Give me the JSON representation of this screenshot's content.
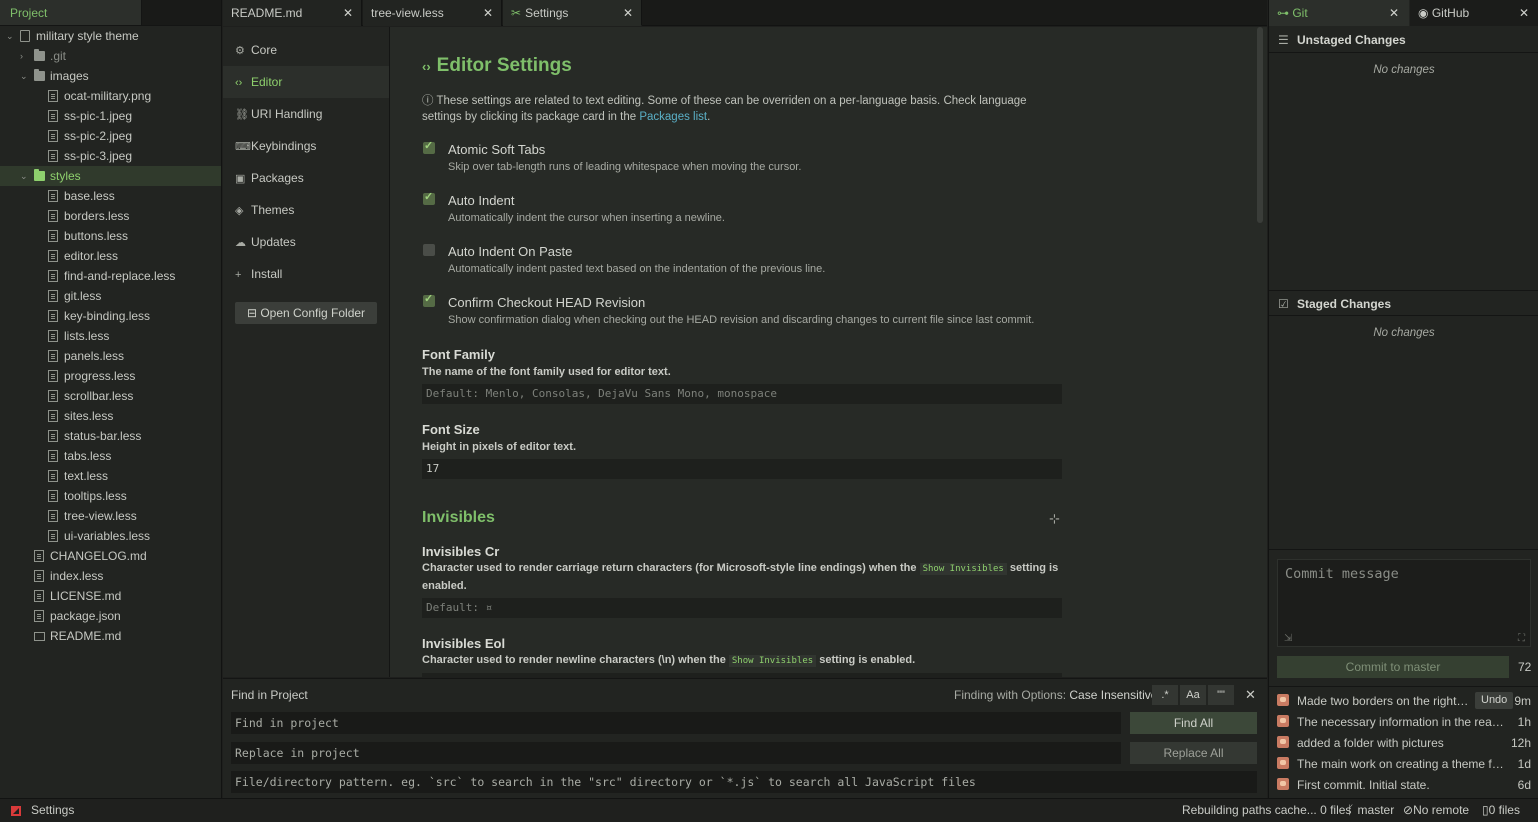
{
  "left_panel": {
    "tab_label": "Project",
    "tree": [
      {
        "label": "military style theme",
        "type": "repo",
        "depth": 0,
        "chevron": "down"
      },
      {
        "label": ".git",
        "type": "folder",
        "depth": 1,
        "chevron": "right",
        "dim": true
      },
      {
        "label": "images",
        "type": "folder",
        "depth": 1,
        "chevron": "down"
      },
      {
        "label": "ocat-military.png",
        "type": "file",
        "depth": 2
      },
      {
        "label": "ss-pic-1.jpeg",
        "type": "file",
        "depth": 2
      },
      {
        "label": "ss-pic-2.jpeg",
        "type": "file",
        "depth": 2
      },
      {
        "label": "ss-pic-3.jpeg",
        "type": "file",
        "depth": 2
      },
      {
        "label": "styles",
        "type": "folder",
        "depth": 1,
        "chevron": "down",
        "selected": true
      },
      {
        "label": "base.less",
        "type": "file",
        "depth": 2
      },
      {
        "label": "borders.less",
        "type": "file",
        "depth": 2
      },
      {
        "label": "buttons.less",
        "type": "file",
        "depth": 2
      },
      {
        "label": "editor.less",
        "type": "file",
        "depth": 2
      },
      {
        "label": "find-and-replace.less",
        "type": "file",
        "depth": 2
      },
      {
        "label": "git.less",
        "type": "file",
        "depth": 2
      },
      {
        "label": "key-binding.less",
        "type": "file",
        "depth": 2
      },
      {
        "label": "lists.less",
        "type": "file",
        "depth": 2
      },
      {
        "label": "panels.less",
        "type": "file",
        "depth": 2
      },
      {
        "label": "progress.less",
        "type": "file",
        "depth": 2
      },
      {
        "label": "scrollbar.less",
        "type": "file",
        "depth": 2
      },
      {
        "label": "sites.less",
        "type": "file",
        "depth": 2
      },
      {
        "label": "status-bar.less",
        "type": "file",
        "depth": 2
      },
      {
        "label": "tabs.less",
        "type": "file",
        "depth": 2
      },
      {
        "label": "text.less",
        "type": "file",
        "depth": 2
      },
      {
        "label": "tooltips.less",
        "type": "file",
        "depth": 2
      },
      {
        "label": "tree-view.less",
        "type": "file",
        "depth": 2
      },
      {
        "label": "ui-variables.less",
        "type": "file",
        "depth": 2
      },
      {
        "label": "CHANGELOG.md",
        "type": "file",
        "depth": 1
      },
      {
        "label": "index.less",
        "type": "file",
        "depth": 1
      },
      {
        "label": "LICENSE.md",
        "type": "file",
        "depth": 1
      },
      {
        "label": "package.json",
        "type": "file",
        "depth": 1
      },
      {
        "label": "README.md",
        "type": "book",
        "depth": 1
      }
    ]
  },
  "tabs": [
    {
      "label": "README.md",
      "icon": ""
    },
    {
      "label": "tree-view.less",
      "icon": ""
    },
    {
      "label": "Settings",
      "icon": "wrench-icon",
      "active": true
    }
  ],
  "settings_nav": {
    "items": [
      {
        "label": "Core",
        "icon": "⚙"
      },
      {
        "label": "Editor",
        "icon": "‹›",
        "active": true
      },
      {
        "label": "URI Handling",
        "icon": "⛓"
      },
      {
        "label": "Keybindings",
        "icon": "⌨"
      },
      {
        "label": "Packages",
        "icon": "▣"
      },
      {
        "label": "Themes",
        "icon": "◈"
      },
      {
        "label": "Updates",
        "icon": "☁"
      },
      {
        "label": "Install",
        "icon": "+"
      }
    ],
    "config_button": "Open Config Folder"
  },
  "editor_settings": {
    "title": "Editor Settings",
    "description_pre": "These settings are related to text editing. Some of these can be overriden on a per-language basis. Check language settings by clicking its package card in the ",
    "description_link": "Packages list",
    "description_post": ".",
    "checkboxes": [
      {
        "title": "Atomic Soft Tabs",
        "desc": "Skip over tab-length runs of leading whitespace when moving the cursor.",
        "checked": true
      },
      {
        "title": "Auto Indent",
        "desc": "Automatically indent the cursor when inserting a newline.",
        "checked": true
      },
      {
        "title": "Auto Indent On Paste",
        "desc": "Automatically indent pasted text based on the indentation of the previous line.",
        "checked": false
      },
      {
        "title": "Confirm Checkout HEAD Revision",
        "desc": "Show confirmation dialog when checking out the HEAD revision and discarding changes to current file since last commit.",
        "checked": true
      }
    ],
    "font_family": {
      "title": "Font Family",
      "desc": "The name of the font family used for editor text.",
      "placeholder": "Default: Menlo, Consolas, DejaVu Sans Mono, monospace"
    },
    "font_size": {
      "title": "Font Size",
      "desc": "Height in pixels of editor text.",
      "value": "17"
    }
  },
  "invisibles": {
    "title": "Invisibles",
    "cr": {
      "title": "Invisibles Cr",
      "desc_pre": "Character used to render carriage return characters (for Microsoft-style line endings) when the ",
      "code": "Show Invisibles",
      "desc_post": " setting is enabled.",
      "placeholder": "Default: ¤"
    },
    "eol": {
      "title": "Invisibles Eol",
      "desc_pre": "Character used to render newline characters (\\n) when the ",
      "code": "Show Invisibles",
      "desc_post": " setting is enabled."
    }
  },
  "find_panel": {
    "title": "Find in Project",
    "options_label": "Finding with Options: ",
    "options_value": "Case Insensitive",
    "find_placeholder": "Find in project",
    "replace_placeholder": "Replace in project",
    "path_placeholder": "File/directory pattern. eg. `src` to search in the \"src\" directory or `*.js` to search all JavaScript files",
    "find_all": "Find All",
    "replace_all": "Replace All",
    "opt_regex": ".*",
    "opt_case": "Aa",
    "opt_word": "\"\""
  },
  "git_panel": {
    "tab_git": "Git",
    "tab_github": "GitHub",
    "unstaged_title": "Unstaged Changes",
    "unstaged_empty": "No changes",
    "staged_title": "Staged Changes",
    "staged_empty": "No changes",
    "commit_placeholder": "Commit message",
    "commit_button": "Commit to master",
    "commit_count": "72",
    "undo_label": "Undo",
    "recent_commits": [
      {
        "message": "Made two borders on the right ...",
        "time": "9m",
        "undo": true
      },
      {
        "message": "The necessary information in the readme...",
        "time": "1h"
      },
      {
        "message": "added a folder with pictures",
        "time": "12h"
      },
      {
        "message": "The main work on creating a theme for ...",
        "time": "1d"
      },
      {
        "message": "First commit. Initial state.",
        "time": "6d"
      }
    ]
  },
  "status_bar": {
    "label": "Settings",
    "cache": "Rebuilding paths cache... 0 files",
    "branch": "master",
    "remote": "No remote",
    "files": "0 files"
  },
  "colors": {
    "accent": "#7fbf6a",
    "link": "#5bb0c7",
    "error": "#d83a3a",
    "background": "#272a26"
  }
}
